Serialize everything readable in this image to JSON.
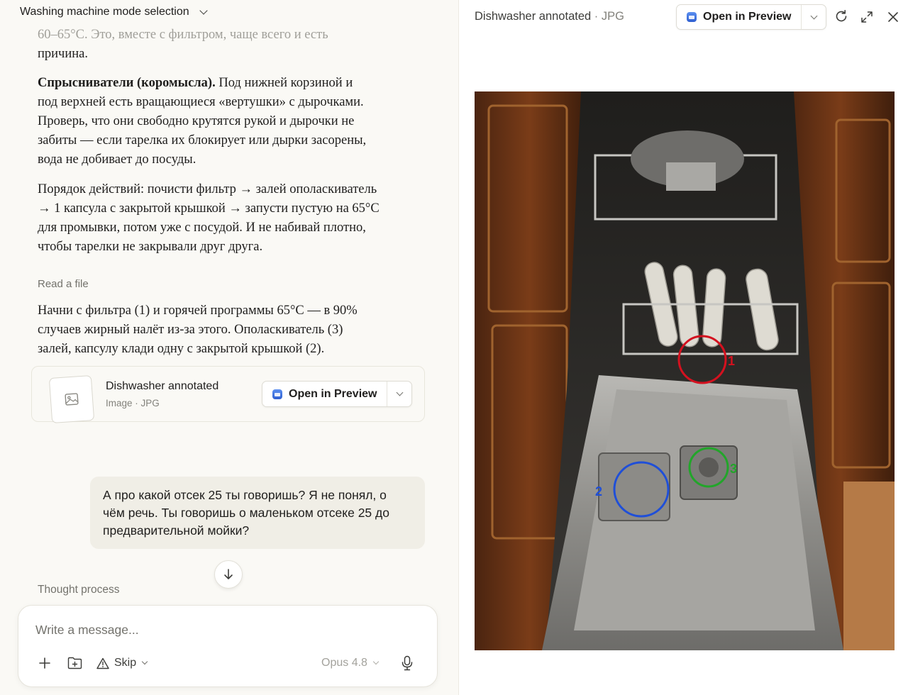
{
  "chat": {
    "title": "Washing machine mode selection",
    "faded_line": "60–65°C. Это, вместе с фильтром, чаще всего и есть",
    "p0_end": "причина.",
    "p1_bold": "Спрысниватели (коромысла).",
    "p1_l1": " Под нижней корзиной и",
    "p1_l2": "под верхней есть вращающиеся «вертушки» с дырочками.",
    "p1_l3": "Проверь, что они свободно крутятся рукой и дырочки не",
    "p1_l4": "забиты — если тарелка их блокирует или дырки засорены,",
    "p1_l5": "вода не добивает до посуды.",
    "p2_l1": "Порядок действий: почисти фильтр → залей ополаскиватель",
    "p2_l2": "→ 1 капсула с закрытой крышкой → запусти пустую на 65°C",
    "p2_l3": "для промывки, потом уже с посудой. И не набивай плотно,",
    "p2_l4": "чтобы тарелки не закрывали друг друга.",
    "read_file": "Read a file",
    "p3_l1": "Начни с фильтра (1) и горячей программы 65°C — в 90%",
    "p3_l2": "случаев жирный налёт из-за этого. Ополаскиватель (3)",
    "p3_l3": "залей, капсулу клади одну с закрытой крышкой (2).",
    "file_card": {
      "name": "Dishwasher annotated",
      "meta": "Image · JPG",
      "open_label": "Open in Preview"
    },
    "user_l1": "А про какой отсек 25 ты говоришь? Я не понял, о",
    "user_l2": "чём речь. Ты говоришь о маленьком отсеке 25 до",
    "user_l3": "предварительной мойки?",
    "thought": "Thought process",
    "composer": {
      "placeholder": "Write a message...",
      "skip": "Skip",
      "model": "Opus 4.8"
    }
  },
  "preview": {
    "filename": "Dishwasher annotated",
    "filetype": " · JPG",
    "open_label": "Open in Preview",
    "annotations": [
      "1",
      "2",
      "3"
    ]
  },
  "icons": [
    "chevron-down-icon",
    "image-icon",
    "preview-app-icon",
    "arrow-down-icon",
    "plus-icon",
    "folder-add-icon",
    "warning-icon",
    "mic-icon",
    "refresh-icon",
    "expand-icon",
    "close-icon"
  ],
  "colors": {
    "accent_red": "#d4111f",
    "accent_blue": "#1f4fd8",
    "accent_green": "#22a52a"
  }
}
